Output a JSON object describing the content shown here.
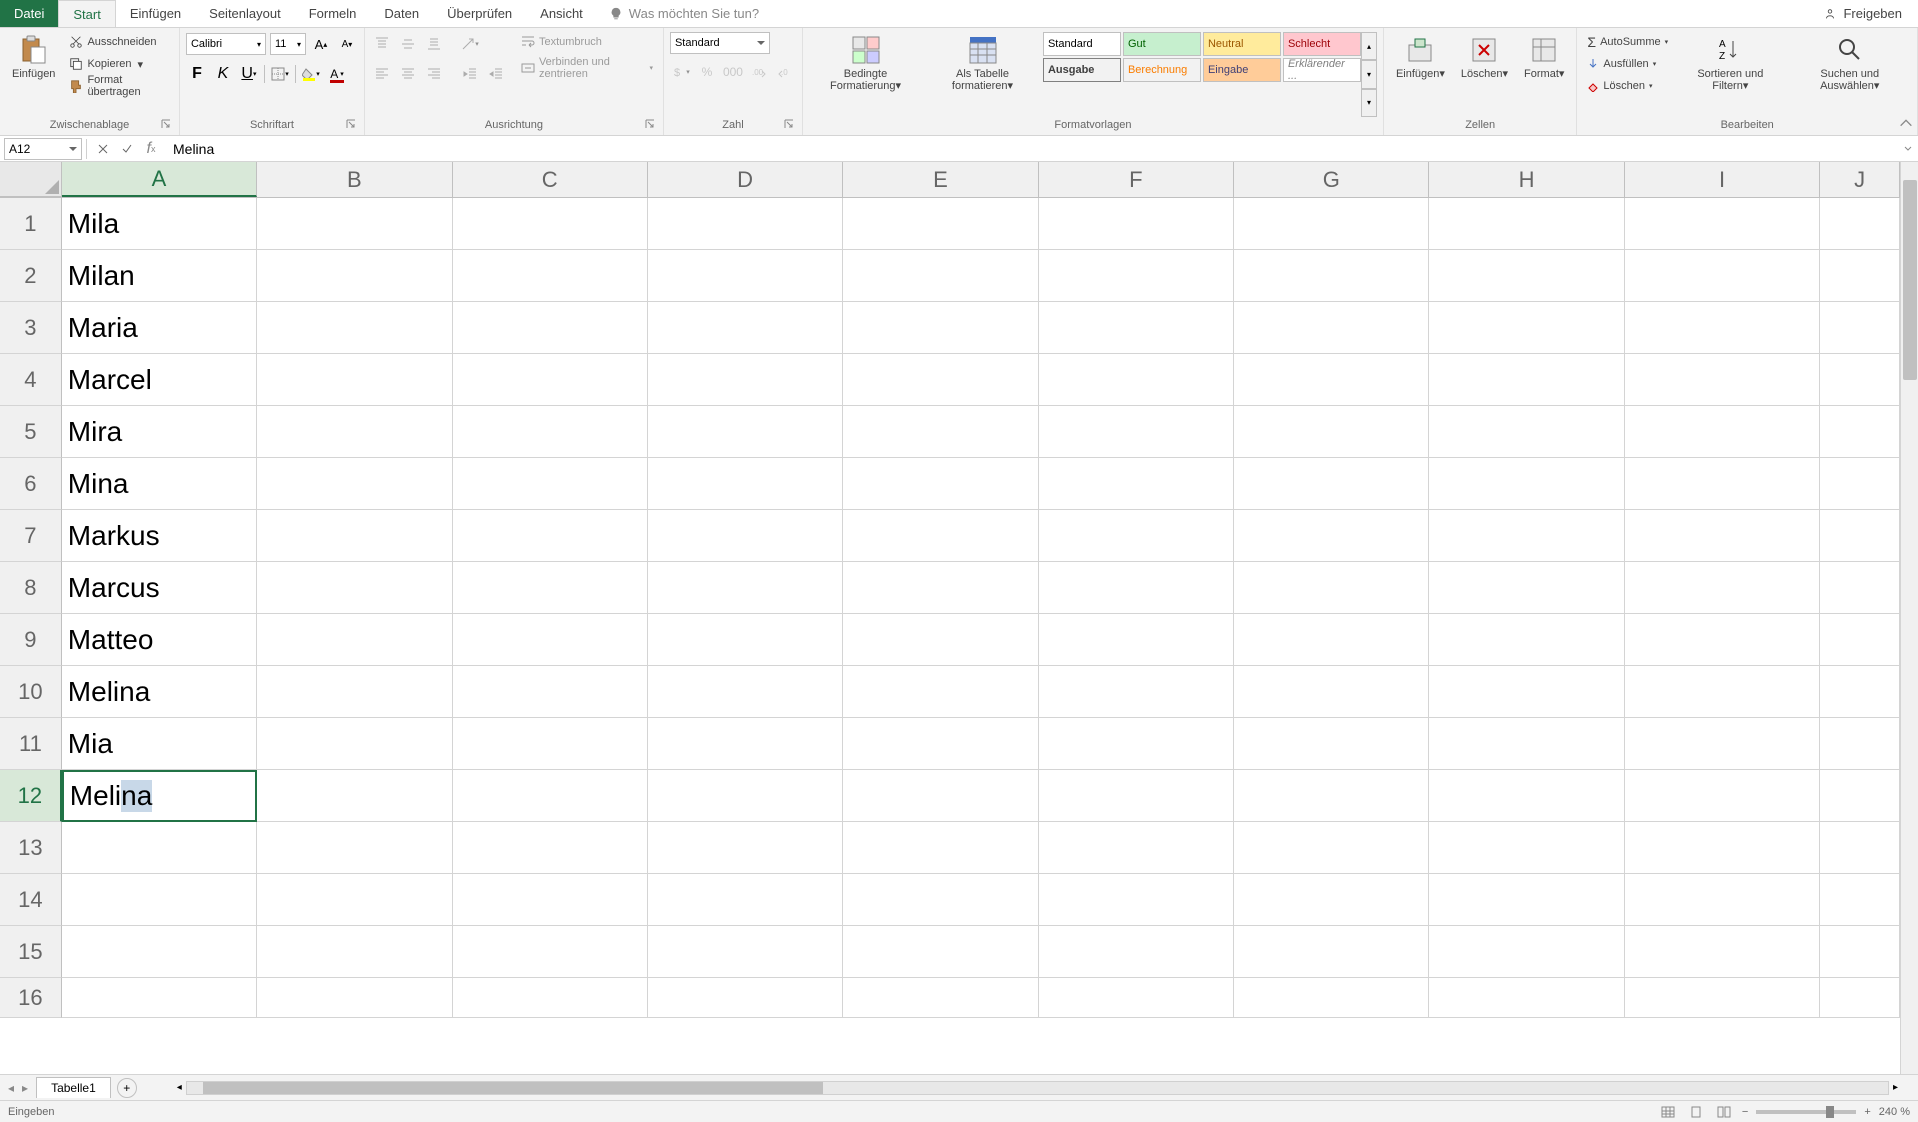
{
  "tabs": {
    "file": "Datei",
    "start": "Start",
    "einfugen": "Einfügen",
    "seitenlayout": "Seitenlayout",
    "formeln": "Formeln",
    "daten": "Daten",
    "uberprufen": "Überprüfen",
    "ansicht": "Ansicht",
    "tellme": "Was möchten Sie tun?",
    "share": "Freigeben"
  },
  "ribbon": {
    "clipboard": {
      "paste": "Einfügen",
      "cut": "Ausschneiden",
      "copy": "Kopieren",
      "formatpainter": "Format übertragen",
      "label": "Zwischenablage"
    },
    "font": {
      "name": "Calibri",
      "size": "11",
      "label": "Schriftart"
    },
    "alignment": {
      "wrap": "Textumbruch",
      "merge": "Verbinden und zentrieren",
      "label": "Ausrichtung"
    },
    "number": {
      "format": "Standard",
      "label": "Zahl"
    },
    "styles": {
      "conditional": "Bedingte Formatierung",
      "astable": "Als Tabelle formatieren",
      "standard": "Standard",
      "gut": "Gut",
      "neutral": "Neutral",
      "schlecht": "Schlecht",
      "ausgabe": "Ausgabe",
      "berechnung": "Berechnung",
      "eingabe": "Eingabe",
      "erklarender": "Erklärender ...",
      "label": "Formatvorlagen"
    },
    "cells": {
      "insert": "Einfügen",
      "delete": "Löschen",
      "format": "Format",
      "label": "Zellen"
    },
    "editing": {
      "autosum": "AutoSumme",
      "fill": "Ausfüllen",
      "clear": "Löschen",
      "sort": "Sortieren und Filtern",
      "find": "Suchen und Auswählen",
      "label": "Bearbeiten"
    }
  },
  "namebox": "A12",
  "formula": "Melina",
  "columns": [
    "A",
    "B",
    "C",
    "D",
    "E",
    "F",
    "G",
    "H",
    "I",
    "J"
  ],
  "chart_data": {
    "type": "table",
    "columns": [
      "A"
    ],
    "rows": [
      {
        "n": 1,
        "A": "Mila"
      },
      {
        "n": 2,
        "A": "Milan"
      },
      {
        "n": 3,
        "A": "Maria"
      },
      {
        "n": 4,
        "A": "Marcel"
      },
      {
        "n": 5,
        "A": "Mira"
      },
      {
        "n": 6,
        "A": "Mina"
      },
      {
        "n": 7,
        "A": "Markus"
      },
      {
        "n": 8,
        "A": "Marcus"
      },
      {
        "n": 9,
        "A": "Matteo"
      },
      {
        "n": 10,
        "A": "Melina"
      },
      {
        "n": 11,
        "A": "Mia"
      },
      {
        "n": 12,
        "A": "Melina"
      },
      {
        "n": 13,
        "A": ""
      },
      {
        "n": 14,
        "A": ""
      },
      {
        "n": 15,
        "A": ""
      },
      {
        "n": 16,
        "A": ""
      }
    ],
    "active_cell": "A12",
    "editing": {
      "typed": "Meli",
      "suggested": "na"
    }
  },
  "sheet": {
    "name": "Tabelle1"
  },
  "status": {
    "mode": "Eingeben",
    "zoom": "240 %"
  }
}
